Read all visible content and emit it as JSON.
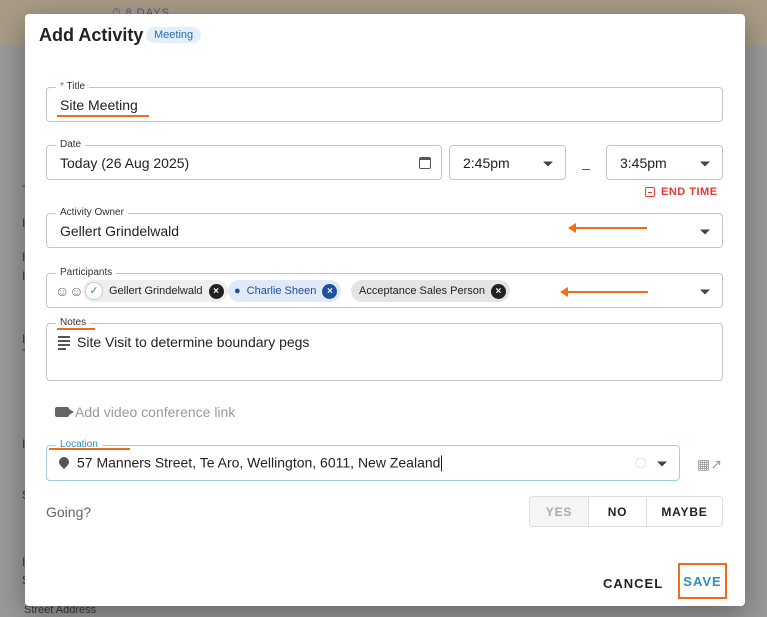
{
  "background": {
    "days_label": "⏱ 8 DAYS",
    "fragments": [
      "T",
      "I",
      "I",
      "I",
      "I",
      "T",
      "I",
      "S",
      "I",
      "S"
    ],
    "street_label": "Street Address"
  },
  "dialog": {
    "title": "Add Activity",
    "badge": "Meeting"
  },
  "title_field": {
    "required_mark": "*",
    "label": "Title",
    "value": "Site Meeting"
  },
  "date_field": {
    "label": "Date",
    "value": "Today (26 Aug 2025)"
  },
  "time": {
    "start": "2:45pm",
    "separator": "–",
    "end": "3:45pm",
    "end_time_label": "END TIME"
  },
  "owner_field": {
    "label": "Activity Owner",
    "value": "Gellert Grindelwald"
  },
  "participants_field": {
    "label": "Participants",
    "chips": [
      {
        "name": "Gellert Grindelwald",
        "check": "✓",
        "remove": "×"
      },
      {
        "name": "Charlie Sheen",
        "remove": "×"
      },
      {
        "name": "Acceptance Sales Person",
        "remove": "×"
      }
    ]
  },
  "notes_field": {
    "label": "Notes",
    "value": "Site Visit to determine boundary pegs"
  },
  "video_link": {
    "label": "Add video conference link"
  },
  "location_field": {
    "label": "Location",
    "value": "57 Manners Street, Te Aro, Wellington, 6011, New Zealand"
  },
  "going": {
    "label": "Going?",
    "options": [
      "YES",
      "NO",
      "MAYBE"
    ]
  },
  "actions": {
    "cancel": "CANCEL",
    "save": "SAVE"
  },
  "colors": {
    "annotation": "#f26b1d",
    "accent_blue": "#2b8fc4",
    "danger": "#e53935"
  },
  "icons": {
    "participants": "people-icon",
    "notes": "notes-icon",
    "video": "video-camera-icon",
    "location": "map-pin-icon",
    "map": "map-icon",
    "calendar": "calendar-icon"
  }
}
